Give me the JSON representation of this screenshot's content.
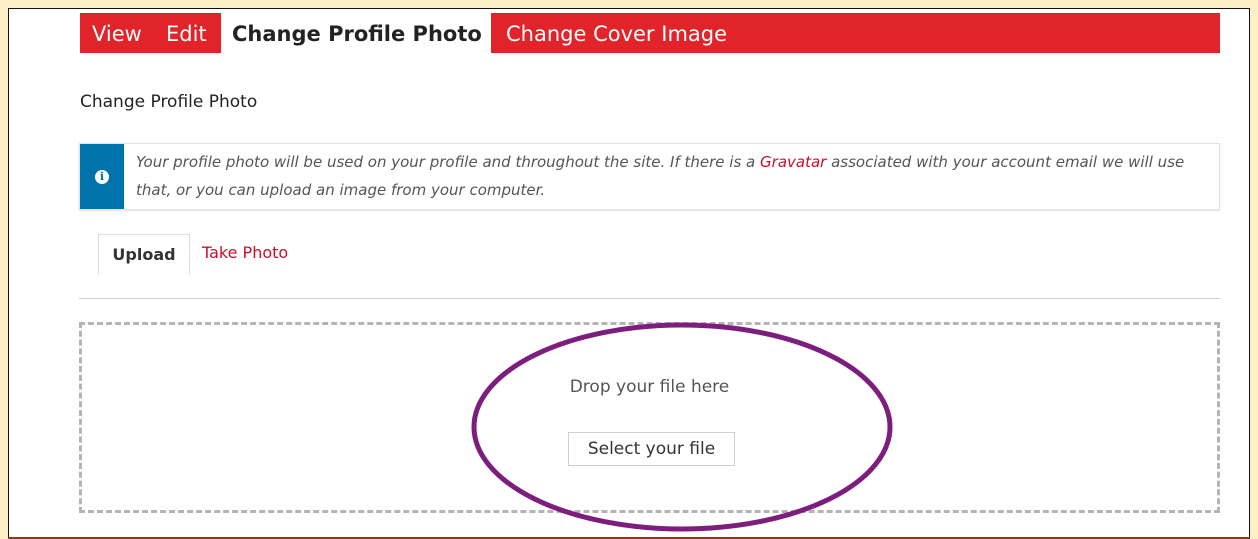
{
  "tabs": {
    "view": "View",
    "edit": "Edit",
    "change_profile_photo": "Change Profile Photo",
    "change_cover_image": "Change Cover Image"
  },
  "section": {
    "title": "Change Profile Photo"
  },
  "info": {
    "text_before": "Your profile photo will be used on your profile and throughout the site. If there is a ",
    "link": "Gravatar",
    "text_after": " associated with your account email we will use that, or you can upload an image from your computer."
  },
  "subtabs": {
    "upload": "Upload",
    "take_photo": "Take Photo"
  },
  "dropzone": {
    "drop_text": "Drop your file here",
    "select_button": "Select your file"
  },
  "colors": {
    "tabbar": "#e2232a",
    "info_accent": "#0073aa",
    "link": "#c8102e",
    "annotation": "#7d1e7e"
  }
}
